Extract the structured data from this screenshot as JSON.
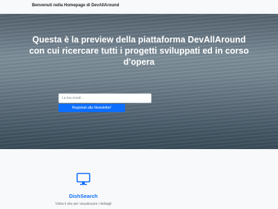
{
  "header": {
    "brand": "Benvenuti nella Homepage di DevAllAround"
  },
  "hero": {
    "title": "Questa è la preview della piattaforma DevAllAround con cui ricercare tutti i progetti sviluppati ed in corso d'opera",
    "email_placeholder": "La tua email...",
    "signup_label": "Registrati alla Newsletter!"
  },
  "features": [
    {
      "icon": "monitor-icon",
      "title": "DishSearch",
      "description": "Visita il sito per visualizzare i dettagli"
    }
  ],
  "colors": {
    "accent": "#0d6efd",
    "hero_overlay": "#6d7f8c",
    "topbar": "#f8f9fa"
  }
}
